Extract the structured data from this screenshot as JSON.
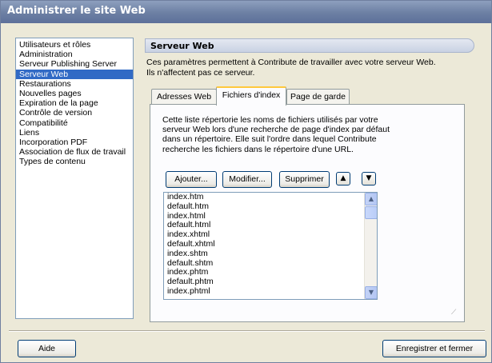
{
  "window": {
    "title": "Administrer le site Web"
  },
  "categories": [
    "Utilisateurs et rôles",
    "Administration",
    "Serveur Publishing Server",
    "Serveur Web",
    "Restaurations",
    "Nouvelles pages",
    "Expiration de la page",
    "Contrôle de version",
    "Compatibilité",
    "Liens",
    "Incorporation PDF",
    "Association de flux de travail",
    "Types de contenu"
  ],
  "selected_category": "Serveur Web",
  "section": {
    "title": "Serveur Web",
    "description_line1": "Ces paramètres permettent à Contribute de travailler avec votre serveur Web.",
    "description_line2": "Ils n'affectent pas ce serveur."
  },
  "tabs": [
    {
      "label": "Adresses Web",
      "active": false
    },
    {
      "label": "Fichiers d'index",
      "active": true
    },
    {
      "label": "Page de garde",
      "active": false
    }
  ],
  "panel": {
    "text_lines": [
      "Cette liste répertorie les noms de fichiers utilisés par votre",
      "serveur Web lors d'une recherche de page d'index par défaut",
      "dans un répertoire. Elle suit l'ordre dans lequel Contribute",
      "recherche les fichiers dans le répertoire d'une URL."
    ],
    "buttons": {
      "add": "Ajouter...",
      "edit": "Modifier...",
      "delete": "Supprimer"
    },
    "move_up_icon": "triangle-up-icon",
    "move_down_icon": "triangle-down-icon",
    "files": [
      "index.htm",
      "default.htm",
      "index.html",
      "default.html",
      "index.xhtml",
      "default.xhtml",
      "index.shtm",
      "default.shtm",
      "index.phtm",
      "default.phtm",
      "index.phtml"
    ]
  },
  "footer": {
    "help_label": "Aide",
    "save_close_label": "Enregistrer et fermer"
  },
  "colors": {
    "selection": "#316ac5",
    "titlebar": "#6c7fa3",
    "tab_accent": "#ffc83c",
    "background": "#ece9d8"
  }
}
